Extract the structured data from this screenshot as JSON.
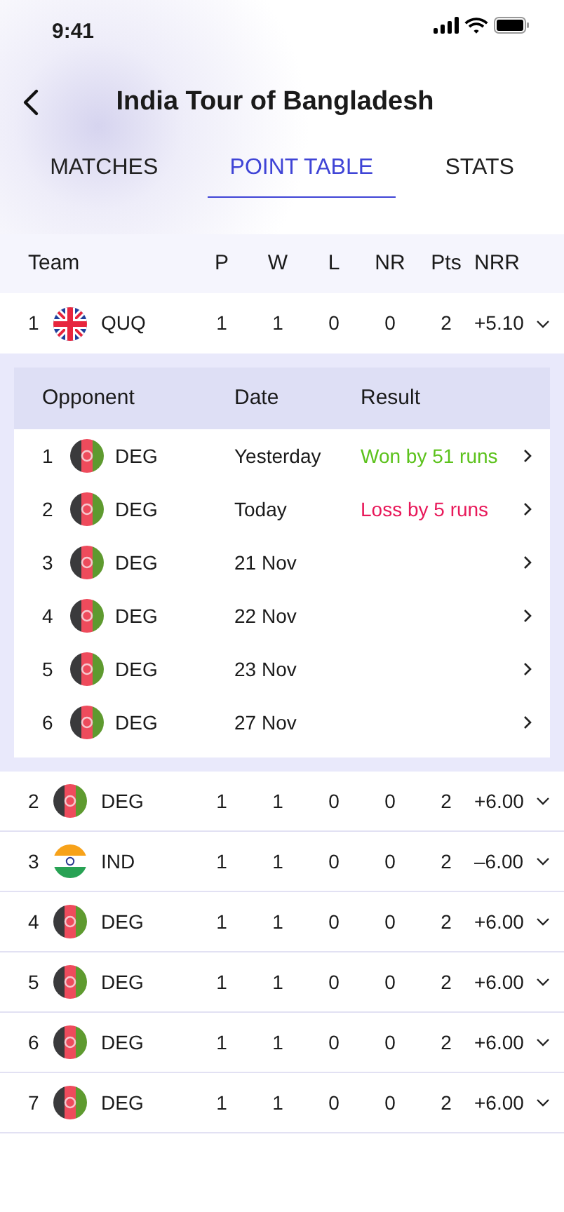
{
  "status_bar": {
    "time": "9:41"
  },
  "header": {
    "title": "India Tour of Bangladesh"
  },
  "tabs": [
    {
      "label": "MATCHES",
      "selected": false
    },
    {
      "label": "POINT TABLE",
      "selected": true
    },
    {
      "label": "STATS",
      "selected": false
    }
  ],
  "table": {
    "columns": [
      "Team",
      "P",
      "W",
      "L",
      "NR",
      "Pts",
      "NRR"
    ],
    "rows": [
      {
        "rank": "1",
        "flag": {
          "kind": "uk"
        },
        "team": "QUQ",
        "p": "1",
        "w": "1",
        "l": "0",
        "nr": "0",
        "pts": "2",
        "nrr": "+5.10",
        "expanded": true,
        "matches": {
          "columns": [
            "Opponent",
            "Date",
            "Result"
          ],
          "rows": [
            {
              "rank": "1",
              "flag": {
                "kind": "afg"
              },
              "team": "DEG",
              "date": "Yesterday",
              "result": {
                "text": "Won by 51 runs",
                "color": "#5cc21c"
              }
            },
            {
              "rank": "2",
              "flag": {
                "kind": "afg"
              },
              "team": "DEG",
              "date": "Today",
              "result": {
                "text": "Loss by 5 runs",
                "color": "#e8195a"
              }
            },
            {
              "rank": "3",
              "flag": {
                "kind": "afg"
              },
              "team": "DEG",
              "date": "21 Nov"
            },
            {
              "rank": "4",
              "flag": {
                "kind": "afg"
              },
              "team": "DEG",
              "date": "22 Nov"
            },
            {
              "rank": "5",
              "flag": {
                "kind": "afg"
              },
              "team": "DEG",
              "date": "23 Nov"
            },
            {
              "rank": "6",
              "flag": {
                "kind": "afg"
              },
              "team": "DEG",
              "date": "27 Nov"
            }
          ]
        }
      },
      {
        "rank": "2",
        "flag": {
          "kind": "afg"
        },
        "team": "DEG",
        "p": "1",
        "w": "1",
        "l": "0",
        "nr": "0",
        "pts": "2",
        "nrr": "+6.00",
        "expanded": false
      },
      {
        "rank": "3",
        "flag": {
          "kind": "ind"
        },
        "team": "IND",
        "p": "1",
        "w": "1",
        "l": "0",
        "nr": "0",
        "pts": "2",
        "nrr": "–6.00",
        "expanded": false
      },
      {
        "rank": "4",
        "flag": {
          "kind": "afg"
        },
        "team": "DEG",
        "p": "1",
        "w": "1",
        "l": "0",
        "nr": "0",
        "pts": "2",
        "nrr": "+6.00",
        "expanded": false
      },
      {
        "rank": "5",
        "flag": {
          "kind": "afg"
        },
        "team": "DEG",
        "p": "1",
        "w": "1",
        "l": "0",
        "nr": "0",
        "pts": "2",
        "nrr": "+6.00",
        "expanded": false
      },
      {
        "rank": "6",
        "flag": {
          "kind": "afg"
        },
        "team": "DEG",
        "p": "1",
        "w": "1",
        "l": "0",
        "nr": "0",
        "pts": "2",
        "nrr": "+6.00",
        "expanded": false
      },
      {
        "rank": "7",
        "flag": {
          "kind": "afg"
        },
        "team": "DEG",
        "p": "1",
        "w": "1",
        "l": "0",
        "nr": "0",
        "pts": "2",
        "nrr": "+6.00",
        "expanded": false
      }
    ]
  }
}
